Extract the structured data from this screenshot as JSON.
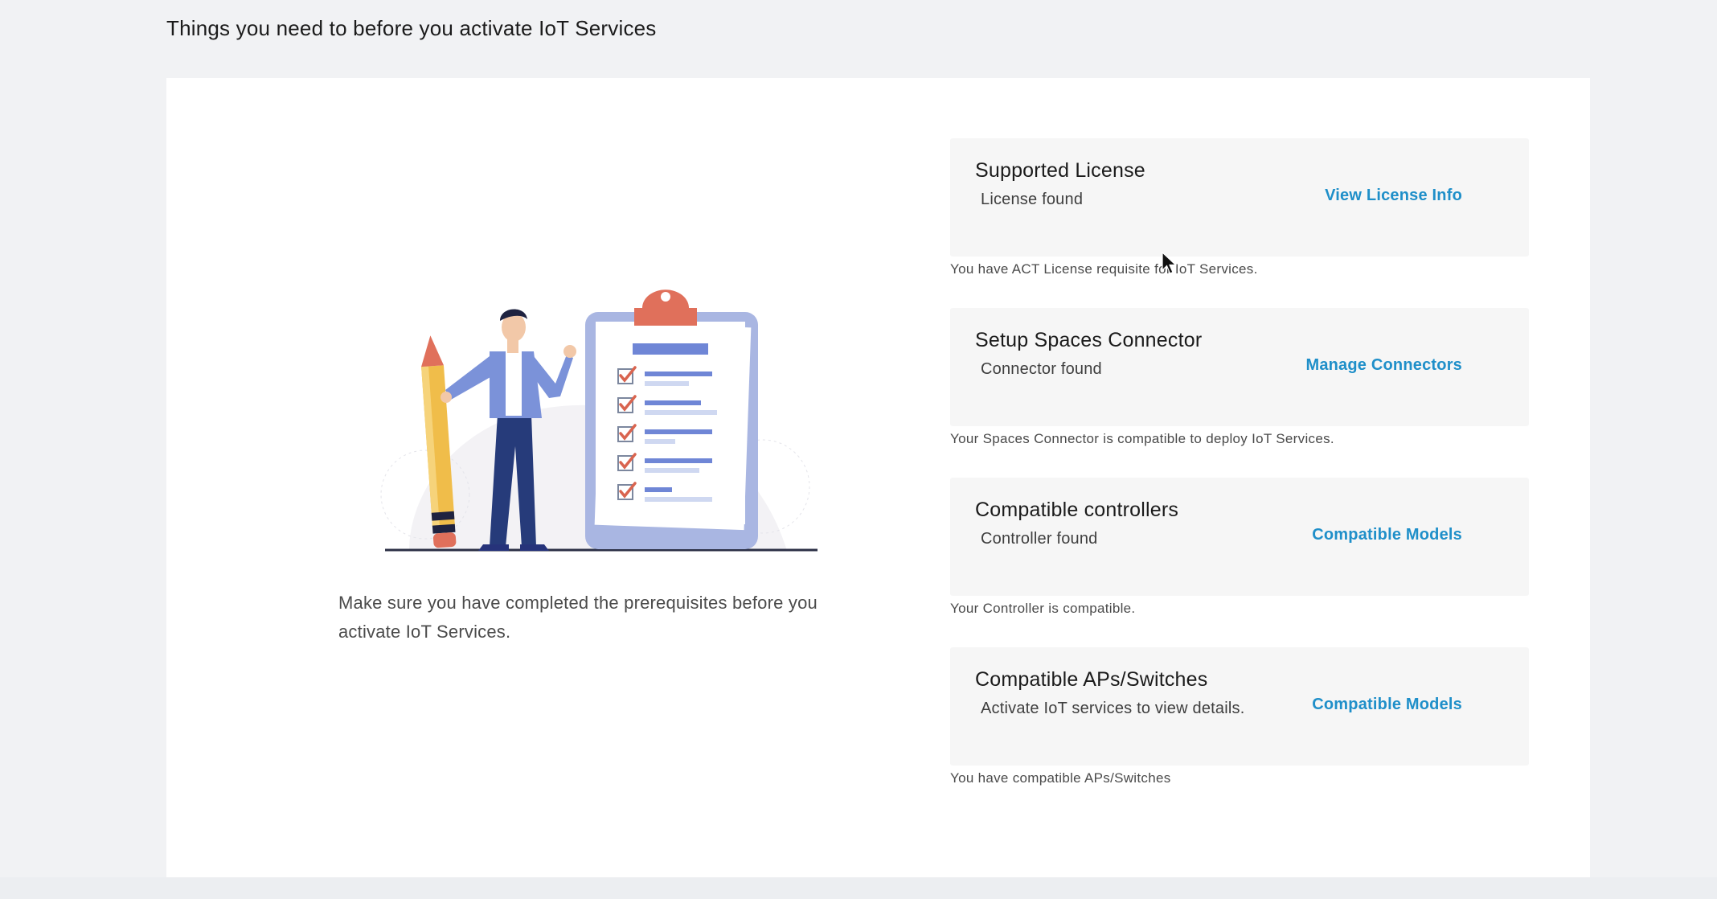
{
  "page": {
    "heading": "Things you need to before you activate IoT Services"
  },
  "intro": {
    "text": "Make sure you have completed the prerequisites before you activate IoT Services."
  },
  "illustration": {
    "icon": "checklist-illustration",
    "colors": {
      "board": "#a9b6e2",
      "clip": "#e0705b",
      "check": "#d9644f",
      "line": "#6f86d6",
      "pencil": "#f0bd4a",
      "person_jacket": "#7b92d9",
      "person_pants": "#263b7a"
    }
  },
  "checks": [
    {
      "title": "Supported License",
      "status": "License found",
      "link": "View License Info",
      "note": "You have ACT License requisite for IoT Services."
    },
    {
      "title": "Setup Spaces Connector",
      "status": "Connector found",
      "link": "Manage Connectors",
      "note": "Your Spaces Connector is compatible to deploy IoT Services."
    },
    {
      "title": "Compatible controllers",
      "status": "Controller found",
      "link": "Compatible Models",
      "note": "Your Controller is compatible."
    },
    {
      "title": "Compatible APs/Switches",
      "status": "Activate IoT services to view details.",
      "link": "Compatible Models",
      "note": "You have compatible APs/Switches"
    }
  ],
  "colors": {
    "background": "#f1f2f4",
    "panel": "#ffffff",
    "card": "#f6f6f6",
    "link": "#1f8fc9"
  }
}
